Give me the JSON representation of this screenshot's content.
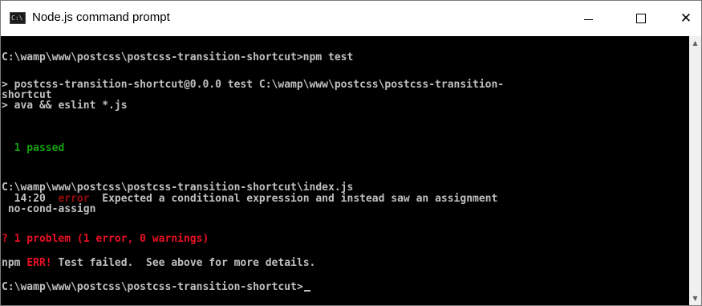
{
  "window": {
    "title": "Node.js command prompt",
    "icon": "cmd-icon",
    "icon_text": "C:\\",
    "controls": {
      "minimize": "minimize-icon",
      "maximize": "maximize-icon",
      "close": "close-icon",
      "close_glyph": "✕"
    }
  },
  "console": {
    "colors": {
      "background": "#000000",
      "text": "#c0c0c0",
      "success": "#13a10e",
      "error": "#e81123",
      "error_dim": "#9b0b0b"
    },
    "lines": [
      "C:\\wamp\\www\\postcss\\postcss-transition-shortcut>npm test",
      "> postcss-transition-shortcut@0.0.0 test C:\\wamp\\www\\postcss\\postcss-transition-",
      "shortcut",
      "> ava && eslint *.js",
      "  1 passed",
      "C:\\wamp\\www\\postcss\\postcss-transition-shortcut\\index.js",
      {
        "location": "  14:20",
        "severity": "error",
        "message": "Expected a conditional expression and instead saw an assignment"
      },
      " no-cond-assign",
      "? 1 problem (1 error, 0 warnings)",
      {
        "prefix": "npm",
        "badge": "ERR!",
        "message": "Test failed.  See above for more details."
      },
      "C:\\wamp\\www\\postcss\\postcss-transition-shortcut>"
    ]
  },
  "scrollbar": {
    "up_glyph": "▲",
    "down_glyph": "▼"
  }
}
